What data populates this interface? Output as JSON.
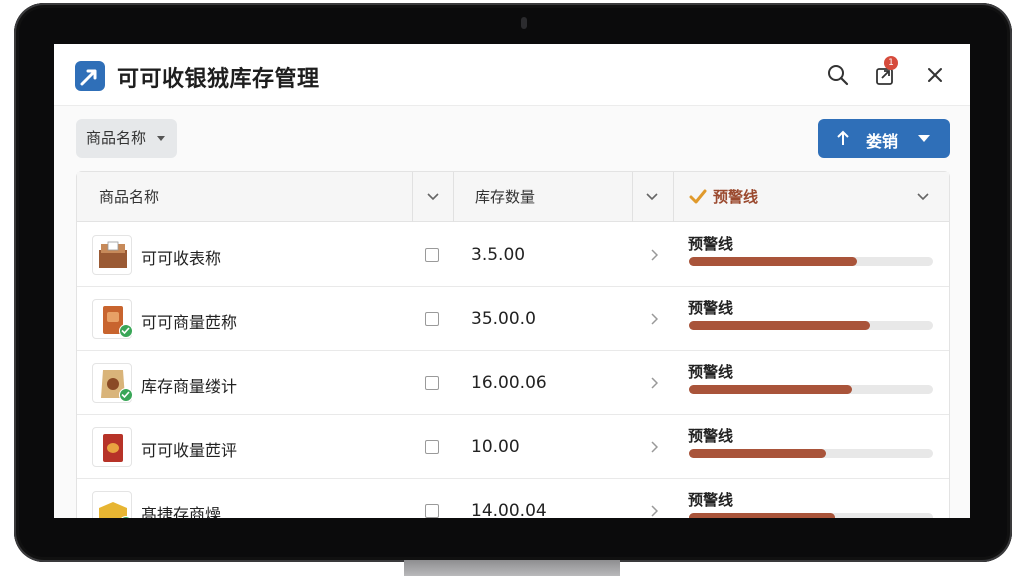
{
  "app": {
    "title": "可可收银狨库存管理",
    "notification_count": "1"
  },
  "toolbar": {
    "filter_label": "商品名称",
    "primary_button_label": "娄销"
  },
  "table": {
    "columns": [
      {
        "label": "商品名称"
      },
      {
        "label": "库存数量"
      },
      {
        "label": "预警线"
      }
    ],
    "rows": [
      {
        "name": "可可收表称",
        "qty": "3.5.00",
        "warn_label": "预警线",
        "level": 0.69,
        "checked_badge": false
      },
      {
        "name": "可可商量苉称",
        "qty": "35.00.0",
        "warn_label": "预警线",
        "level": 0.74,
        "checked_badge": true
      },
      {
        "name": "库存商量缕计",
        "qty": "16.00.06",
        "warn_label": "预警线",
        "level": 0.67,
        "checked_badge": true
      },
      {
        "name": "可可收量苉评",
        "qty": "10.00",
        "warn_label": "预警线",
        "level": 0.56,
        "checked_badge": false
      },
      {
        "name": "髙捷存商燥",
        "qty": "14.00.04",
        "warn_label": "预警线",
        "level": 0.6,
        "checked_badge": true
      }
    ]
  },
  "colors": {
    "accent": "#2f6fb8",
    "warning_bar": "#a9543a",
    "warning_icon": "#e09a2c",
    "badge_green": "#39a657"
  }
}
